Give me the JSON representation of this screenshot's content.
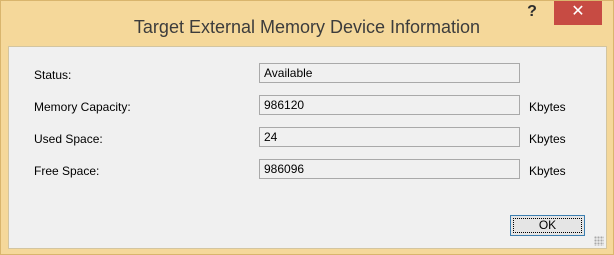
{
  "window": {
    "title": "Target External Memory Device Information",
    "help_label": "?",
    "close_label": "✕"
  },
  "fields": [
    {
      "label": "Status:",
      "value": "Available",
      "unit": ""
    },
    {
      "label": "Memory Capacity:",
      "value": "986120",
      "unit": "Kbytes"
    },
    {
      "label": "Used Space:",
      "value": "24",
      "unit": "Kbytes"
    },
    {
      "label": "Free Space:",
      "value": "986096",
      "unit": "Kbytes"
    }
  ],
  "buttons": {
    "ok_label": "OK"
  },
  "colors": {
    "titlebar": "#f5d89a",
    "close_button": "#c74b43",
    "client_background": "#f0f0f0"
  }
}
